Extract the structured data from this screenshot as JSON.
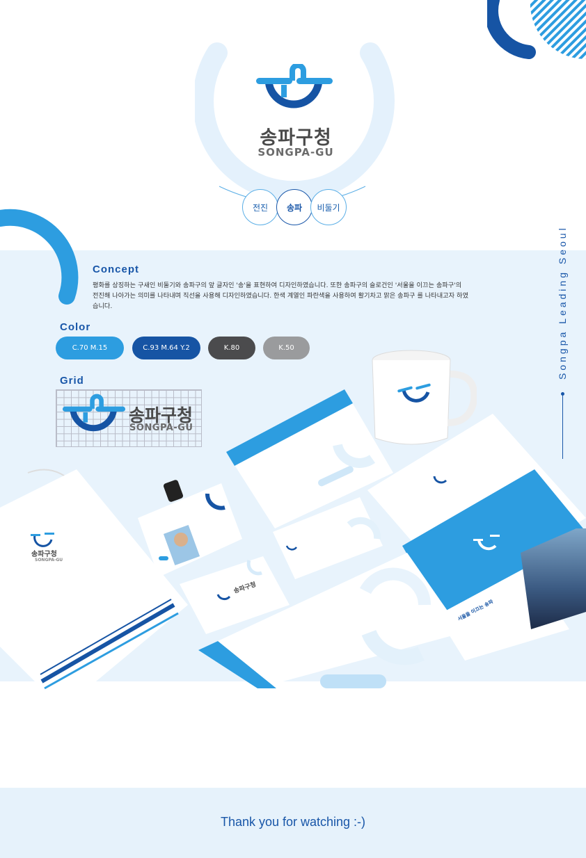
{
  "hero": {
    "logo_korean": "송파구청",
    "logo_english": "SONGPA-GU",
    "concept_words": [
      "전진",
      "송파",
      "비둘기"
    ]
  },
  "concept": {
    "title": "Concept",
    "body": "평화를 상징하는 구새인 비둘기와 송파구의 앞 글자인 '송'을 표현하여 디자인하였습니다. 또한 송파구의 슬로건인 '서울을 이끄는 송파구'의 전진해 나아가는 의미를 나타내며 직선을 사용해 디자인하였습니다. 한색 계열인 파란색을 사용하여 활기차고 맑은 송파구 를 나타내고자 하였습니다."
  },
  "color": {
    "title": "Color",
    "swatches": [
      {
        "label": "C.70  M.15",
        "hex": "#2d9de0"
      },
      {
        "label": "C.93  M.64  Y.2",
        "hex": "#1654a4"
      },
      {
        "label": "K.80",
        "hex": "#4b4b4d"
      },
      {
        "label": "K.50",
        "hex": "#9a9b9d"
      }
    ]
  },
  "grid": {
    "title": "Grid",
    "logo_korean": "송파구청",
    "logo_english": "SONGPA-GU"
  },
  "side_slogan": "Songpa Leading Seoul",
  "mockups": {
    "bag_logo_korean": "송파구청",
    "bag_logo_english": "SONGPA-GU",
    "card_logo_korean": "송파구청",
    "card_logo_english": "SONGPA-GU",
    "brochure_heading": "서울을 이끄는 송파"
  },
  "footer": {
    "thanks": "Thank you for watching :-)"
  },
  "colors": {
    "primary": "#1856a8",
    "accent": "#2d9de0",
    "light_band": "#e8f3fc"
  }
}
